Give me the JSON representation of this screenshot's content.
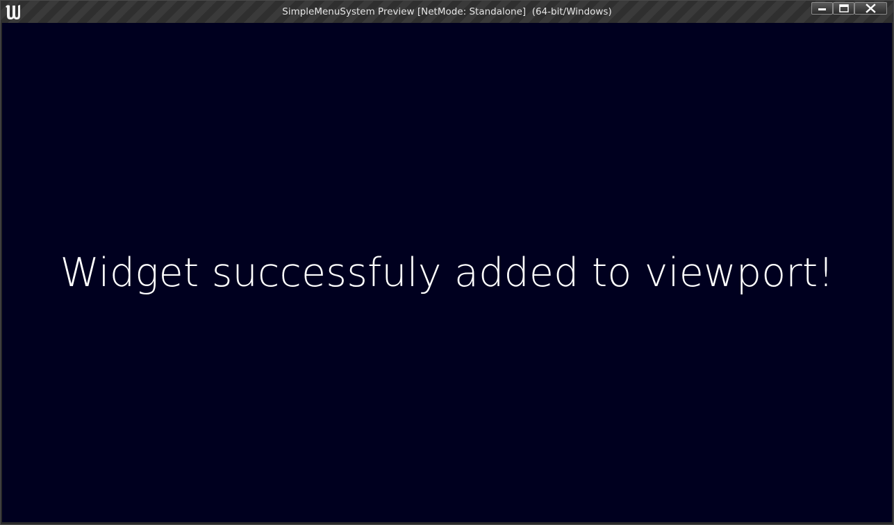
{
  "window": {
    "title": "SimpleMenuSystem Preview [NetMode: Standalone]  (64-bit/Windows)",
    "app_icon": "unreal-engine-logo-icon",
    "controls": {
      "minimize_icon": "minimize-icon",
      "maximize_icon": "maximize-icon",
      "close_icon": "close-icon"
    }
  },
  "viewport": {
    "background_color": "#00001f",
    "message": "Widget successfuly added to viewport!",
    "message_color": "#ffffff"
  }
}
